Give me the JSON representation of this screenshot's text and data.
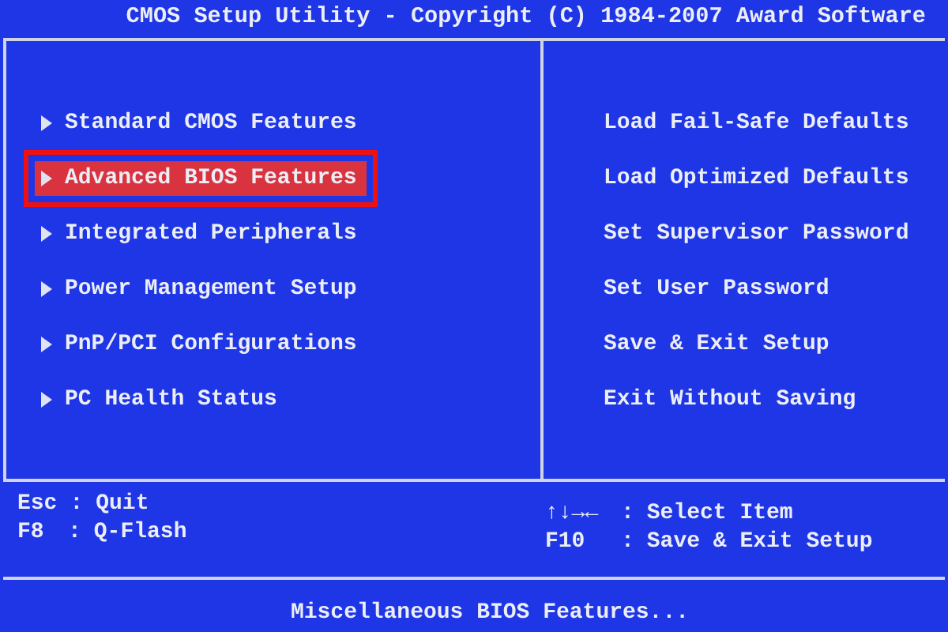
{
  "title": "CMOS Setup Utility - Copyright (C) 1984-2007 Award Software",
  "left_menu": [
    {
      "label": "Standard CMOS Features",
      "selected": false
    },
    {
      "label": "Advanced BIOS Features",
      "selected": true
    },
    {
      "label": "Integrated Peripherals",
      "selected": false
    },
    {
      "label": "Power Management Setup",
      "selected": false
    },
    {
      "label": "PnP/PCI Configurations",
      "selected": false
    },
    {
      "label": "PC Health Status",
      "selected": false
    }
  ],
  "right_menu": [
    "Load Fail-Safe Defaults",
    "Load Optimized Defaults",
    "Set Supervisor Password",
    "Set User Password",
    "Save & Exit Setup",
    "Exit Without Saving"
  ],
  "keys_left": [
    {
      "key": "Esc",
      "sep": ":",
      "action": "Quit"
    },
    {
      "key": "F8",
      "sep": ":",
      "action": "Q-Flash"
    }
  ],
  "keys_right": [
    {
      "key": "↑↓→←",
      "sep": ":",
      "action": "Select Item"
    },
    {
      "key": "F10",
      "sep": ":",
      "action": "Save & Exit Setup"
    }
  ],
  "status": "Miscellaneous BIOS Features..."
}
